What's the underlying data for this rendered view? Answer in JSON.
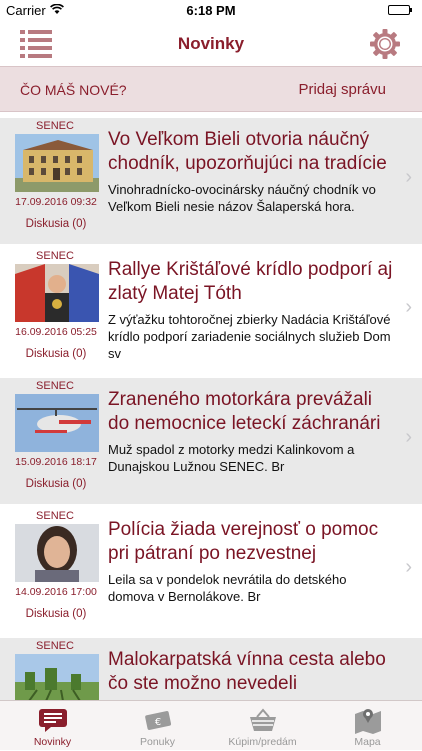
{
  "status_bar": {
    "carrier": "Carrier",
    "time": "6:18 PM"
  },
  "nav": {
    "title": "Novinky"
  },
  "compose": {
    "prompt": "ČO MÁŠ NOVÉ?",
    "add_label": "Pridaj správu"
  },
  "news": [
    {
      "region": "SENEC",
      "headline": "Vo Veľkom Bieli otvoria náučný chodník, upozorňujúci na tradície",
      "summary": "Vinohradnícko-ovocinársky náučný chodník vo Veľkom Bieli nesie názov Šalaperská hora.",
      "date": "17.09.2016 09:32",
      "discussion": "Diskusia (0)"
    },
    {
      "region": "SENEC",
      "headline": "Rallye Krištáľové krídlo podporí aj zlatý Matej Tóth",
      "summary": "Z výťažku tohtoročnej zbierky Nadácia Krištáľové krídlo podporí zariadenie sociálnych služieb Dom sv",
      "date": "16.09.2016 05:25",
      "discussion": "Diskusia (0)"
    },
    {
      "region": "SENEC",
      "headline": "Zraneného motorkára prevážali do nemocnice leteckí záchranári",
      "summary": "Muž spadol z motorky medzi Kalinkovom a Dunajskou Lužnou SENEC. Br",
      "date": "15.09.2016 18:17",
      "discussion": "Diskusia (0)"
    },
    {
      "region": "SENEC",
      "headline": "Polícia žiada verejnosť o pomoc pri pátraní po nezvestnej",
      "summary": "Leila sa v pondelok nevrátila do detského domova v Bernolákove. Br",
      "date": "14.09.2016 17:00",
      "discussion": "Diskusia (0)"
    },
    {
      "region": "SENEC",
      "headline": "Malokarpatská vínna cesta alebo čo ste možno nevedeli",
      "summary": "",
      "date": "",
      "discussion": ""
    }
  ],
  "tabs": [
    {
      "label": "Novinky",
      "icon": "news-icon",
      "active": true
    },
    {
      "label": "Ponuky",
      "icon": "offers-icon",
      "active": false
    },
    {
      "label": "Kúpim/predám",
      "icon": "basket-icon",
      "active": false
    },
    {
      "label": "Mapa",
      "icon": "map-icon",
      "active": false
    }
  ],
  "colors": {
    "accent": "#8a1e2c",
    "headline": "#7a1424",
    "compose_bg": "#ecdee0",
    "alt_row": "#e9e9e9",
    "tab_inactive": "#999999"
  }
}
